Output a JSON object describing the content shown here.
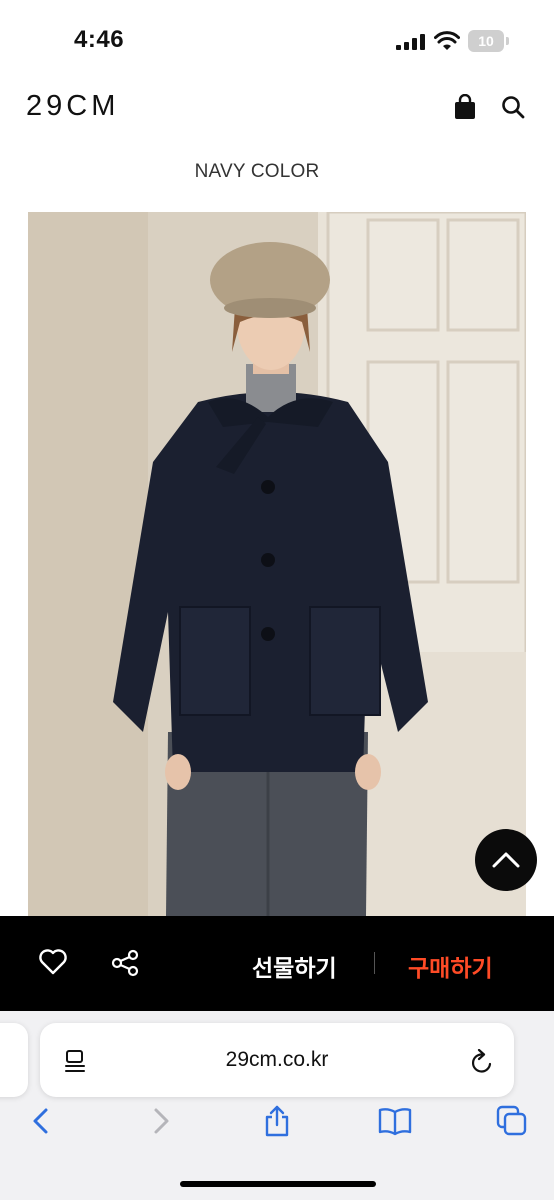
{
  "status_bar": {
    "time": "4:46",
    "battery": "10"
  },
  "header": {
    "logo": "29CM",
    "icons": [
      "shopping-bag-icon",
      "search-icon"
    ]
  },
  "product": {
    "color_label": "NAVY COLOR",
    "image": "model-wearing-navy-coat-photo"
  },
  "scroll_top": {
    "icon": "chevron-up-icon"
  },
  "action_bar": {
    "wishlist_icon": "heart-icon",
    "share_icon": "share-icon",
    "gift_label": "선물하기",
    "buy_label": "구매하기",
    "buy_color": "#ff4b26",
    "background": "#000000"
  },
  "browser": {
    "url": "29cm.co.kr",
    "toolbar": [
      "back-icon",
      "forward-icon",
      "share-icon",
      "bookmarks-icon",
      "tabs-icon"
    ]
  }
}
